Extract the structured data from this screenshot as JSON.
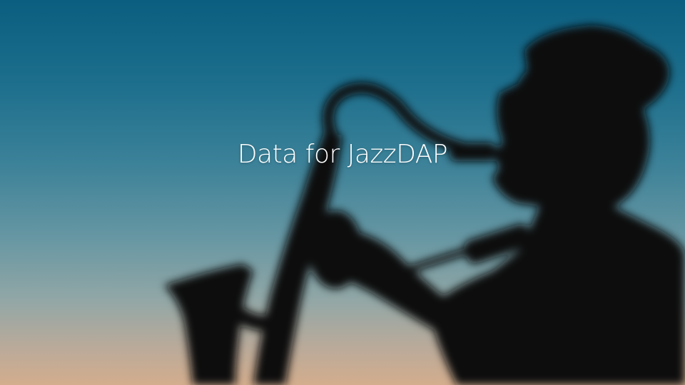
{
  "slide": {
    "title": "Data for JazzDAP"
  },
  "background": {
    "image_subject": "saxophone-player-silhouette",
    "colors": {
      "sky_top": "#0c5e80",
      "sky_mid": "#6797a3",
      "sky_bottom": "#d3ad8d",
      "silhouette": "#0a0c0e",
      "title_text": "#ffffff"
    }
  }
}
